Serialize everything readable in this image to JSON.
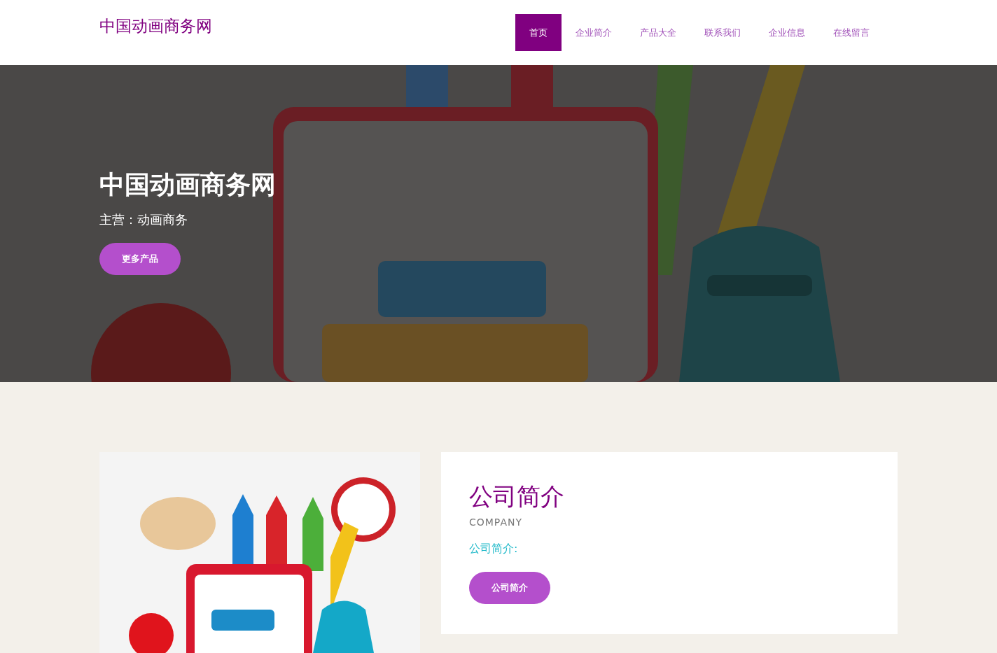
{
  "header": {
    "logo": "中国动画商务网",
    "nav": [
      {
        "label": "首页",
        "selected": true
      },
      {
        "label": "企业简介",
        "selected": false
      },
      {
        "label": "产品大全",
        "selected": false
      },
      {
        "label": "联系我们",
        "selected": false
      },
      {
        "label": "企业信息",
        "selected": false
      },
      {
        "label": "在线留言",
        "selected": false
      }
    ]
  },
  "hero": {
    "title": "中国动画商务网",
    "subtitle": "主营：动画商务",
    "button": "更多产品",
    "kind": "picture"
  },
  "about": {
    "title": "公司简介",
    "subtitle": "COMPANY",
    "text": "公司简介:",
    "button": "公司简介"
  }
}
